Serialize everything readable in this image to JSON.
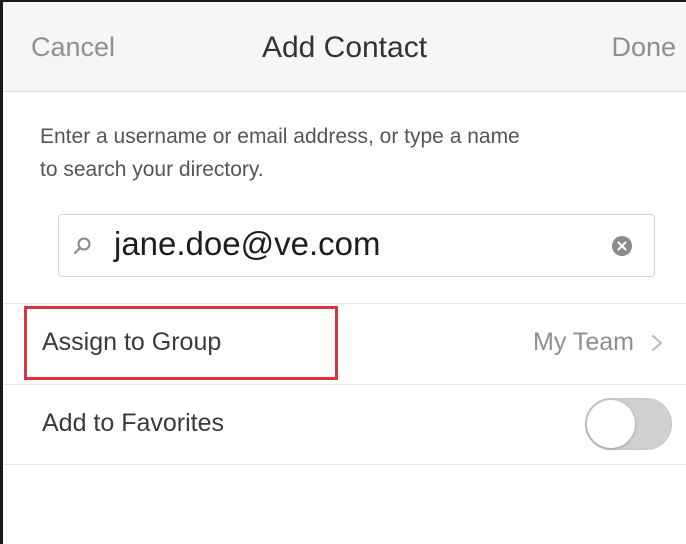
{
  "navbar": {
    "cancel_label": "Cancel",
    "title": "Add Contact",
    "done_label": "Done"
  },
  "instructions": {
    "line1": "Enter a username or email address, or type a name",
    "line2": "to search your directory."
  },
  "search": {
    "value": "jane.doe@ve.com",
    "icon": "search-icon",
    "clear_icon": "clear-circle-icon"
  },
  "rows": {
    "assign_group": {
      "label": "Assign to Group",
      "value": "My Team",
      "icon": "chevron-right-icon",
      "highlight_color": "#d9333f"
    },
    "favorites": {
      "label": "Add to Favorites",
      "toggle_on": false
    }
  },
  "colors": {
    "navbar_bg": "#f6f6f6",
    "muted_text": "#8e8e93",
    "highlight": "#d9333f"
  }
}
